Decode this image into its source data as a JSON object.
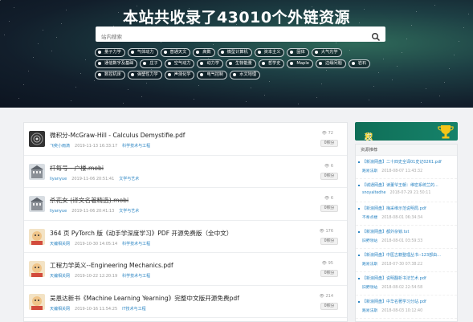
{
  "header": {
    "title": "本站共收录了43010个外链资源",
    "search_placeholder": "站内搜索"
  },
  "tags": [
    "量子力学",
    "气体动力",
    "普通天文",
    "高数",
    "微型计算机",
    "资本主义",
    "固体",
    "大气光学",
    "通信数字及基础",
    "庄子",
    "空气动力",
    "动力学",
    "生物能量",
    "哲学史",
    "Maple",
    "边缘问题",
    "岩石",
    "数控机床",
    "弹塑性力学",
    "声测化学",
    "电气控制",
    "水文地理"
  ],
  "list": [
    {
      "title": "微积分-McGraw-Hill - Calculus Demystifie.pdf",
      "author": "飞奕小雨滴",
      "time": "2019-11-13 16:33:17",
      "category": "科学技术与工程",
      "views": "72",
      "points": "0积分",
      "strike": false,
      "thumb": "dark"
    },
    {
      "title": "杆每号 - 户楼.mobi",
      "author": "liyanyue",
      "time": "2019-11-06 20:51:41",
      "category": "文学与艺术",
      "views": "6",
      "points": "0积分",
      "strike": true,
      "thumb": "building"
    },
    {
      "title": "杀花女 (译文名著精选).mobi",
      "author": "liyanyue",
      "time": "2019-11-06 20:41:13",
      "category": "文学与艺术",
      "views": "6",
      "points": "0积分",
      "strike": true,
      "thumb": "building"
    },
    {
      "title": "364 页 PyTorch 版《动手学深度学习》PDF 开源免费版（全中文）",
      "author": "天编相关网",
      "time": "2019-10-30 14:05:14",
      "category": "科学技术与工程",
      "views": "176",
      "points": "0积分",
      "strike": false,
      "thumb": "cartoon"
    },
    {
      "title": "工程力学英义--Engineering Mechanics.pdf",
      "author": "天编相关网",
      "time": "2019-10-22 12:20:19",
      "category": "科学技术与工程",
      "views": "95",
      "points": "0积分",
      "strike": false,
      "thumb": "cartoon"
    },
    {
      "title": "吴恩达新书《Machine Learning Yearning》完整中文版开源免费pdf",
      "author": "天编相关网",
      "time": "2019-10-16 11:54:25",
      "category": "IT技术与工程",
      "views": "214",
      "points": "0积分",
      "strike": false,
      "thumb": "cartoon"
    }
  ],
  "sidebar": {
    "banner_a": "发布链接赚取",
    "banner_b": "积分",
    "rec_head": "资源推荐",
    "items": [
      {
        "title": "【新浪网盘】二十四史全译01史记0261.pdf",
        "author": "路易法斯",
        "time": "2018-08-07 11:43:32"
      },
      {
        "title": "【城通网盘】读董爷王朝：维密系统兰的...",
        "author": "snoyaltedhe",
        "time": "2018-07-29 21:50:11"
      },
      {
        "title": "【新浪网盘】梅采维示范说明局.pdf",
        "author": "不奉点楼",
        "time": "2018-08-01 06:34:34"
      },
      {
        "title": "【新浪网盘】都外杂锁.txt",
        "author": "旧野领站",
        "time": "2018-08-01 03:59:33"
      },
      {
        "title": "【新浪网盘】中医古籍整理丛书--123部由...",
        "author": "路易法斯",
        "time": "2018-07-30 07:38:22"
      },
      {
        "title": "【新浪网盘】说明翻析书法艺术.pdf",
        "author": "旧野领站",
        "time": "2018-08-02 22:54:58"
      },
      {
        "title": "【新浪网盘】中华名著学习分站.pdf",
        "author": "路易法斯",
        "time": "2018-08-03 10:12:40"
      }
    ]
  }
}
